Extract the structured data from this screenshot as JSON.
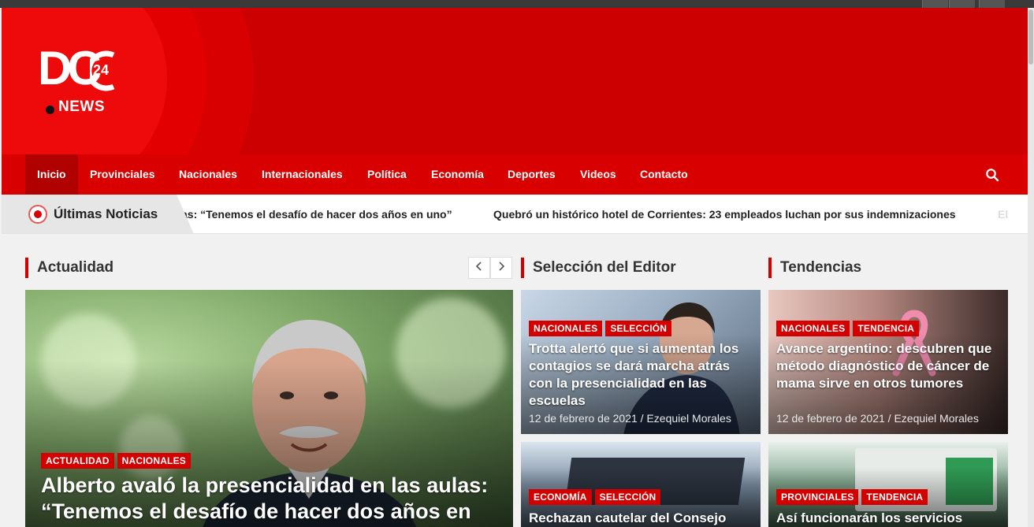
{
  "brand": {
    "logo_letters": "DC",
    "logo_number": "24",
    "logo_word": "NEWS"
  },
  "nav": {
    "items": [
      "Inicio",
      "Provinciales",
      "Nacionales",
      "Internacionales",
      "Política",
      "Economía",
      "Deportes",
      "Videos",
      "Contacto"
    ],
    "active": "Inicio",
    "search_icon": "search-icon"
  },
  "ticker": {
    "label": "Últimas Noticias",
    "headlines": [
      "as: “Tenemos el desafío de hacer dos años en uno”",
      "Quebró un histórico hotel de Corrientes: 23 empleados luchan por sus indemnizaciones",
      "El"
    ]
  },
  "sections": {
    "actualidad": "Actualidad",
    "editor": "Selección del Editor",
    "tendencias": "Tendencias",
    "prev_icon": "chevron-left-icon",
    "next_icon": "chevron-right-icon"
  },
  "main_story": {
    "badges": [
      "ACTUALIDAD",
      "NACIONALES"
    ],
    "title_line1": "Alberto avaló la presencialidad en las aulas:",
    "title_line2": "“Tenemos el desafío de hacer dos años en"
  },
  "editor": [
    {
      "badges": [
        "NACIONALES",
        "SELECCIÓN"
      ],
      "title": "Trotta alertó que si aumentan los contagios se dará marcha atrás con la presencialidad en las escuelas",
      "meta": "12 de febrero de 2021 / Ezequiel Morales"
    },
    {
      "badges": [
        "ECONOMÍA",
        "SELECCIÓN"
      ],
      "title": "Rechazan cautelar del Consejo"
    }
  ],
  "tendencias": [
    {
      "badges": [
        "NACIONALES",
        "TENDENCIA"
      ],
      "title": "Avance argentino: descubren que método diagnóstico de cáncer de mama sirve en otros tumores",
      "meta": "12 de febrero de 2021 / Ezequiel Morales"
    },
    {
      "badges": [
        "PROVINCIALES",
        "TENDENCIA"
      ],
      "title": "Así funcionarán los servicios"
    }
  ],
  "colors": {
    "brand_red": "#cc0000",
    "nav_red": "#d80000",
    "badge_red": "#d40000"
  }
}
